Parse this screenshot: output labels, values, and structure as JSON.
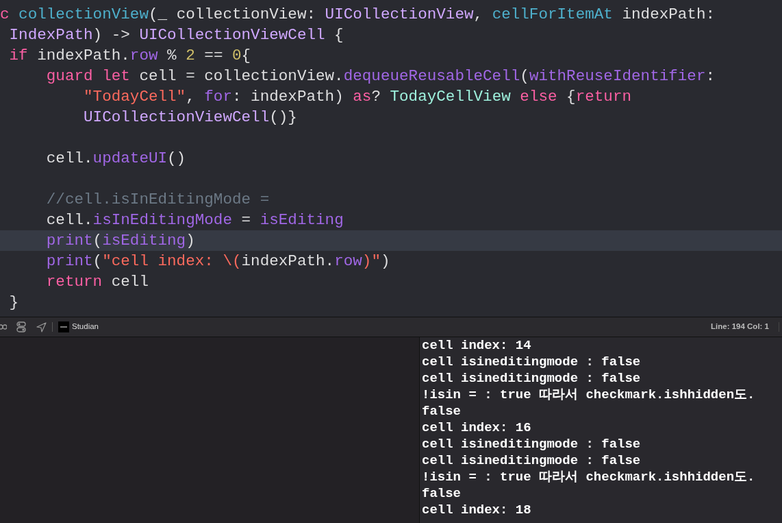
{
  "editor": {
    "lines": [
      {
        "highlighted": false,
        "tokens": [
          {
            "text": "c",
            "kind": "keyword"
          },
          {
            "text": " collectionView",
            "kind": "decl"
          },
          {
            "text": "(_ collectionView: ",
            "kind": "plain"
          },
          {
            "text": "UICollectionView",
            "kind": "type"
          },
          {
            "text": ", ",
            "kind": "plain"
          },
          {
            "text": "cellForItemAt",
            "kind": "decl"
          },
          {
            "text": " indexPath:",
            "kind": "plain"
          }
        ]
      },
      {
        "highlighted": false,
        "tokens": [
          {
            "text": " IndexPath",
            "kind": "type"
          },
          {
            "text": ") -> ",
            "kind": "plain"
          },
          {
            "text": "UICollectionViewCell",
            "kind": "type"
          },
          {
            "text": " {",
            "kind": "plain"
          }
        ]
      },
      {
        "highlighted": false,
        "tokens": [
          {
            "text": " if",
            "kind": "keyword"
          },
          {
            "text": " indexPath.",
            "kind": "plain"
          },
          {
            "text": "row",
            "kind": "method"
          },
          {
            "text": " % ",
            "kind": "plain"
          },
          {
            "text": "2",
            "kind": "number"
          },
          {
            "text": " == ",
            "kind": "plain"
          },
          {
            "text": "0",
            "kind": "number"
          },
          {
            "text": "{",
            "kind": "plain"
          }
        ]
      },
      {
        "highlighted": false,
        "tokens": [
          {
            "text": "     guard",
            "kind": "keyword"
          },
          {
            "text": " let",
            "kind": "keyword"
          },
          {
            "text": " cell = collectionView.",
            "kind": "plain"
          },
          {
            "text": "dequeueReusableCell",
            "kind": "method"
          },
          {
            "text": "(",
            "kind": "plain"
          },
          {
            "text": "withReuseIdentifier",
            "kind": "method"
          },
          {
            "text": ":",
            "kind": "plain"
          }
        ]
      },
      {
        "highlighted": false,
        "tokens": [
          {
            "text": "         \"TodayCell\"",
            "kind": "string"
          },
          {
            "text": ", ",
            "kind": "plain"
          },
          {
            "text": "for",
            "kind": "method"
          },
          {
            "text": ": indexPath) ",
            "kind": "plain"
          },
          {
            "text": "as",
            "kind": "keyword"
          },
          {
            "text": "? ",
            "kind": "plain"
          },
          {
            "text": "TodayCellView",
            "kind": "class"
          },
          {
            "text": " else",
            "kind": "keyword"
          },
          {
            "text": " {",
            "kind": "plain"
          },
          {
            "text": "return",
            "kind": "keyword"
          }
        ]
      },
      {
        "highlighted": false,
        "tokens": [
          {
            "text": "         UICollectionViewCell",
            "kind": "type"
          },
          {
            "text": "()}",
            "kind": "plain"
          }
        ]
      },
      {
        "highlighted": false
      },
      {
        "highlighted": false,
        "tokens": [
          {
            "text": "     cell.",
            "kind": "plain"
          },
          {
            "text": "updateUI",
            "kind": "method"
          },
          {
            "text": "()",
            "kind": "plain"
          }
        ]
      },
      {
        "highlighted": false
      },
      {
        "highlighted": false,
        "tokens": [
          {
            "text": "     //cell.isInEditingMode =",
            "kind": "comment"
          }
        ]
      },
      {
        "highlighted": false,
        "tokens": [
          {
            "text": "     cell.",
            "kind": "plain"
          },
          {
            "text": "isInEditingMode",
            "kind": "method"
          },
          {
            "text": " = ",
            "kind": "plain"
          },
          {
            "text": "isEditing",
            "kind": "method"
          }
        ]
      },
      {
        "highlighted": true,
        "tokens": [
          {
            "text": "     print",
            "kind": "method"
          },
          {
            "text": "(",
            "kind": "plain"
          },
          {
            "text": "isEditing",
            "kind": "method"
          },
          {
            "text": ")",
            "kind": "plain"
          }
        ]
      },
      {
        "highlighted": false,
        "tokens": [
          {
            "text": "     print",
            "kind": "method"
          },
          {
            "text": "(",
            "kind": "plain"
          },
          {
            "text": "\"cell index: \\(",
            "kind": "string"
          },
          {
            "text": "indexPath.",
            "kind": "plain"
          },
          {
            "text": "row",
            "kind": "method"
          },
          {
            "text": ")\"",
            "kind": "string"
          },
          {
            "text": ")",
            "kind": "plain"
          }
        ]
      },
      {
        "highlighted": false,
        "tokens": [
          {
            "text": "     return",
            "kind": "keyword"
          },
          {
            "text": " cell",
            "kind": "plain"
          }
        ]
      },
      {
        "highlighted": false,
        "tokens": [
          {
            "text": " }",
            "kind": "plain"
          }
        ]
      }
    ]
  },
  "debug_bar": {
    "scheme": "Studian",
    "position": "Line: 194  Col: 1"
  },
  "console": {
    "lines": [
      "cell index: 14",
      "cell isineditingmode : false",
      "cell isineditingmode : false",
      "!isin = : true 따라서 checkmark.ishhidden도.",
      "false",
      "cell index: 16",
      "cell isineditingmode : false",
      "cell isineditingmode : false",
      "!isin = : true 따라서 checkmark.ishhidden도.",
      "false",
      "cell index: 18"
    ]
  }
}
